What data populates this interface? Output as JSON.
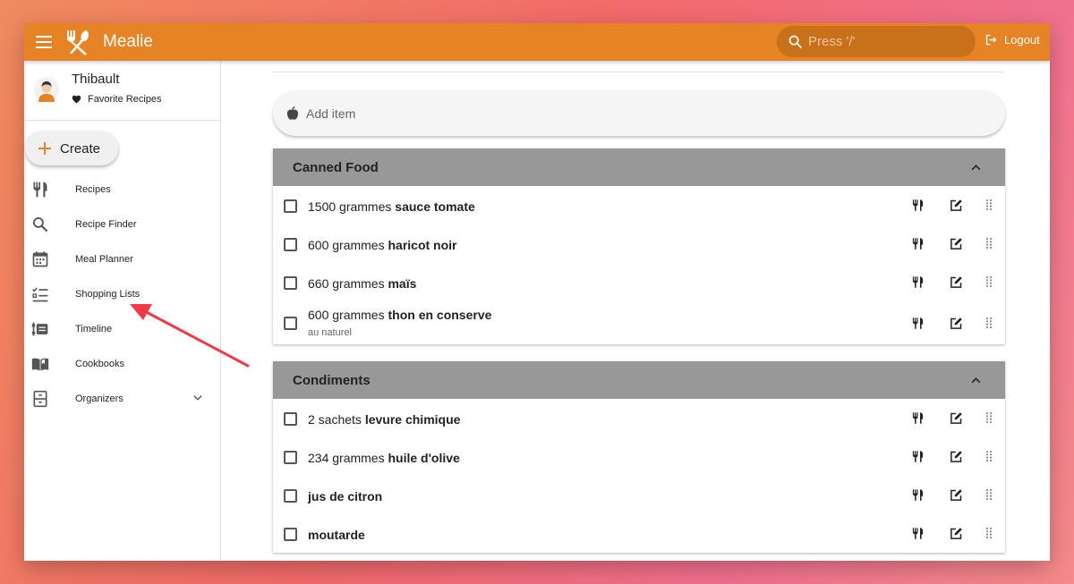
{
  "app": {
    "title": "Mealie",
    "accent": "#e58325"
  },
  "header": {
    "search_placeholder": "Press '/'",
    "logout_label": "Logout"
  },
  "sidebar": {
    "user_name": "Thibault",
    "favorite_label": "Favorite Recipes",
    "create_label": "Create",
    "items": [
      {
        "label": "Recipes",
        "icon": "fork-knife-icon"
      },
      {
        "label": "Recipe Finder",
        "icon": "search-icon"
      },
      {
        "label": "Meal Planner",
        "icon": "calendar-icon"
      },
      {
        "label": "Shopping Lists",
        "icon": "checklist-icon"
      },
      {
        "label": "Timeline",
        "icon": "timeline-icon"
      },
      {
        "label": "Cookbooks",
        "icon": "book-icon"
      },
      {
        "label": "Organizers",
        "icon": "cabinet-icon"
      }
    ]
  },
  "main": {
    "add_item_placeholder": "Add item",
    "sections": [
      {
        "title": "Canned Food",
        "items": [
          {
            "qty": "1500 grammes",
            "name": "sauce tomate",
            "note": ""
          },
          {
            "qty": "600 grammes",
            "name": "haricot noir",
            "note": ""
          },
          {
            "qty": "660 grammes",
            "name": "maïs",
            "note": ""
          },
          {
            "qty": "600 grammes",
            "name": "thon en conserve",
            "note": "au naturel"
          }
        ]
      },
      {
        "title": "Condiments",
        "items": [
          {
            "qty": "2 sachets",
            "name": "levure chimique",
            "note": ""
          },
          {
            "qty": "234 grammes",
            "name": "huile d'olive",
            "note": ""
          },
          {
            "qty": "",
            "name": "jus de citron",
            "note": ""
          },
          {
            "qty": "",
            "name": "moutarde",
            "note": ""
          }
        ]
      }
    ]
  }
}
